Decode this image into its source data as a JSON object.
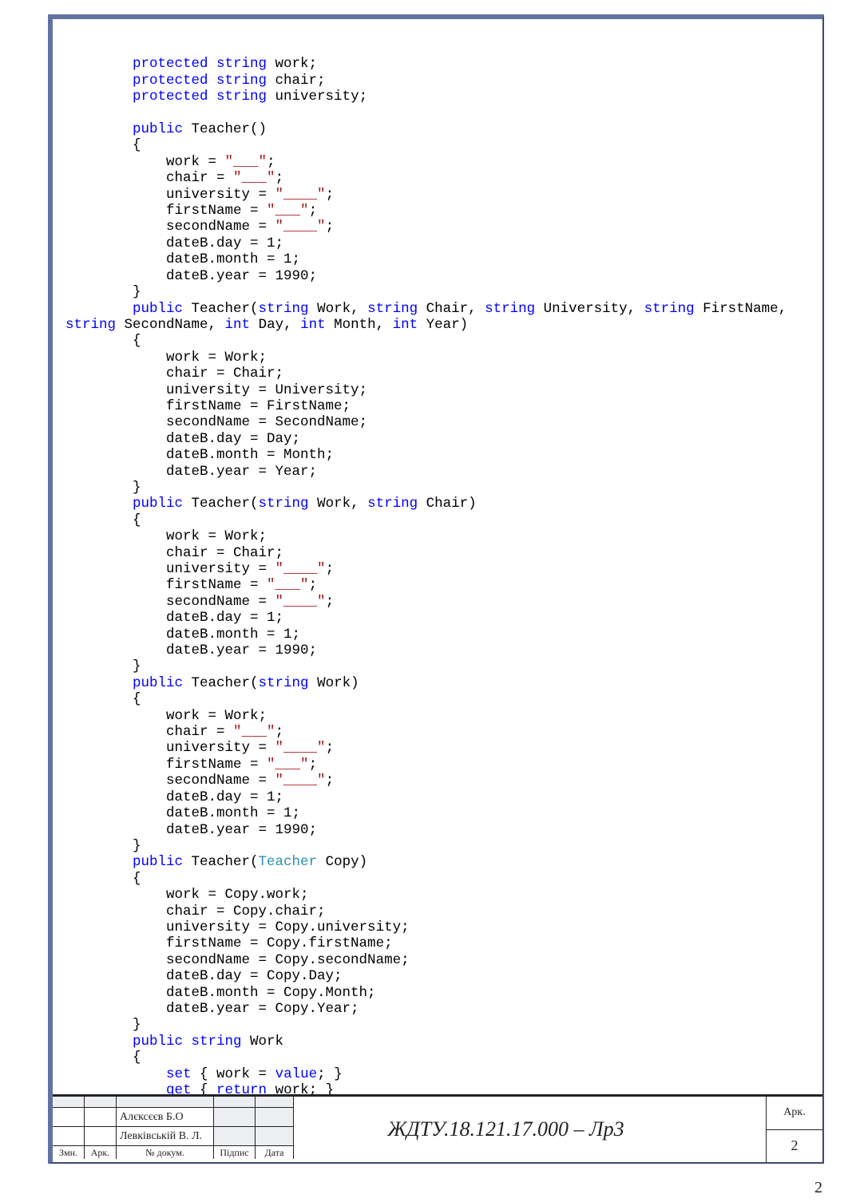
{
  "code": {
    "line1_a": "        protected",
    "line1_b": " string",
    "line1_c": " work;",
    "line2_a": "        protected",
    "line2_b": " string",
    "line2_c": " chair;",
    "line3_a": "        protected",
    "line3_b": " string",
    "line3_c": " university;",
    "blank1": "",
    "line4_a": "        public",
    "line4_b": " Teacher()",
    "line5": "        {",
    "line6_a": "            work = ",
    "line6_b": "\"___\"",
    "line6_c": ";",
    "line7_a": "            chair = ",
    "line7_b": "\"___\"",
    "line7_c": ";",
    "line8_a": "            university = ",
    "line8_b": "\"____\"",
    "line8_c": ";",
    "line9_a": "            firstName = ",
    "line9_b": "\"___\"",
    "line9_c": ";",
    "line10_a": "            secondName = ",
    "line10_b": "\"____\"",
    "line10_c": ";",
    "line11": "            dateB.day = 1;",
    "line12": "            dateB.month = 1;",
    "line13": "            dateB.year = 1990;",
    "line14": "        }",
    "line15_a": "        public",
    "line15_b": " Teacher(",
    "line15_c": "string",
    "line15_d": " Work, ",
    "line15_e": "string",
    "line15_f": " Chair, ",
    "line15_g": "string",
    "line15_h": " University, ",
    "line15_i": "string",
    "line15_j": " FirstName, ",
    "line16_a": "string",
    "line16_b": " SecondName, ",
    "line16_c": "int",
    "line16_d": " Day, ",
    "line16_e": "int",
    "line16_f": " Month, ",
    "line16_g": "int",
    "line16_h": " Year)",
    "line17": "        {",
    "line18": "            work = Work;",
    "line19": "            chair = Chair;",
    "line20": "            university = University;",
    "line21": "            firstName = FirstName;",
    "line22": "            secondName = SecondName;",
    "line23": "            dateB.day = Day;",
    "line24": "            dateB.month = Month;",
    "line25": "            dateB.year = Year;",
    "line26": "        }",
    "line27_a": "        public",
    "line27_b": " Teacher(",
    "line27_c": "string",
    "line27_d": " Work, ",
    "line27_e": "string",
    "line27_f": " Chair)",
    "line28": "        {",
    "line29": "            work = Work;",
    "line30": "            chair = Chair;",
    "line31_a": "            university = ",
    "line31_b": "\"____\"",
    "line31_c": ";",
    "line32_a": "            firstName = ",
    "line32_b": "\"___\"",
    "line32_c": ";",
    "line33_a": "            secondName = ",
    "line33_b": "\"____\"",
    "line33_c": ";",
    "line34": "            dateB.day = 1;",
    "line35": "            dateB.month = 1;",
    "line36": "            dateB.year = 1990;",
    "line37": "        }",
    "line38_a": "        public",
    "line38_b": " Teacher(",
    "line38_c": "string",
    "line38_d": " Work)",
    "line39": "        {",
    "line40": "            work = Work;",
    "line41_a": "            chair = ",
    "line41_b": "\"___\"",
    "line41_c": ";",
    "line42_a": "            university = ",
    "line42_b": "\"____\"",
    "line42_c": ";",
    "line43_a": "            firstName = ",
    "line43_b": "\"___\"",
    "line43_c": ";",
    "line44_a": "            secondName = ",
    "line44_b": "\"____\"",
    "line44_c": ";",
    "line45": "            dateB.day = 1;",
    "line46": "            dateB.month = 1;",
    "line47": "            dateB.year = 1990;",
    "line48": "        }",
    "line49_a": "        public",
    "line49_b": " Teacher(",
    "line49_c": "Teacher",
    "line49_d": " Copy)",
    "line50": "        {",
    "line51": "            work = Copy.work;",
    "line52": "            chair = Copy.chair;",
    "line53": "            university = Copy.university;",
    "line54": "            firstName = Copy.firstName;",
    "line55": "            secondName = Copy.secondName;",
    "line56": "            dateB.day = Copy.Day;",
    "line57": "            dateB.month = Copy.Month;",
    "line58": "            dateB.year = Copy.Year;",
    "line59": "        }",
    "line60_a": "        public",
    "line60_b": " string",
    "line60_c": " Work",
    "line61": "        {",
    "line62_a": "            set",
    "line62_b": " { work = ",
    "line62_c": "value",
    "line62_d": "; }",
    "line63_a": "            get",
    "line63_b": " { ",
    "line63_c": "return",
    "line63_d": " work; }"
  },
  "stamp": {
    "name1": "Алєксєєв Б.О",
    "name2": "Левківській В. Л.",
    "zmn": "Змн.",
    "ark_small": "Арк.",
    "dokum": "№ докум.",
    "pidpys": "Підпис",
    "data": "Дата",
    "title": "ЖДТУ.18.121.17.000 – Лр3",
    "ark": "Арк.",
    "page_small": "2",
    "page_big": "2"
  }
}
